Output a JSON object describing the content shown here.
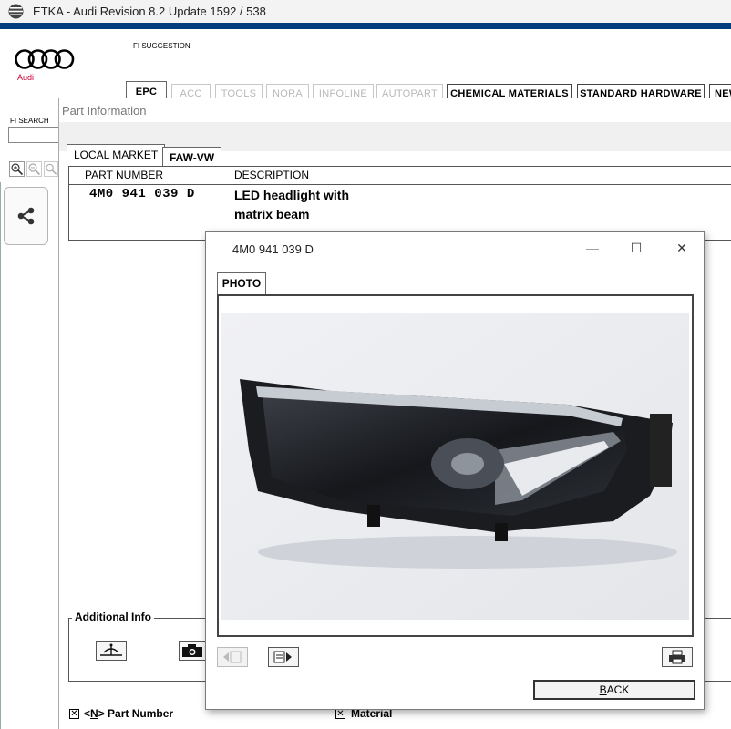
{
  "window": {
    "title": "ETKA - Audi Revision 8.2 Update 1592 / 538"
  },
  "brand": {
    "logo_text": "Audi",
    "brand_color": "#cc0033",
    "header_bar_color": "#003f7d"
  },
  "header": {
    "fi_suggestion": "FI SUGGESTION",
    "tabs": [
      {
        "label": "EPC",
        "state": "active"
      },
      {
        "label": "ACC",
        "state": "disabled"
      },
      {
        "label": "TOOLS",
        "state": "disabled"
      },
      {
        "label": "NORA",
        "state": "disabled"
      },
      {
        "label": "INFOLINE",
        "state": "disabled"
      },
      {
        "label": "AUTOPART",
        "state": "disabled"
      },
      {
        "label": "CHEMICAL MATERIALS",
        "state": "enabled"
      },
      {
        "label": "STANDARD HARDWARE",
        "state": "enabled"
      },
      {
        "label": "NEW",
        "state": "enabled"
      }
    ]
  },
  "sidebar": {
    "fi_search_label": "FI SEARCH",
    "fi_search_value": "",
    "zoom_icons": [
      "zoom-in-icon",
      "zoom-out-icon",
      "zoom-fit-icon"
    ],
    "share_icon": "share-icon"
  },
  "part_info": {
    "title": "Part Information",
    "tabs": [
      {
        "label": "LOCAL MARKET",
        "active": true
      },
      {
        "label": "FAW-VW",
        "active": false
      }
    ],
    "columns": {
      "part_number": "PART NUMBER",
      "description": "DESCRIPTION"
    },
    "rows": [
      {
        "part_number": "4M0  941  039  D",
        "description": "LED headlight with matrix beam"
      }
    ],
    "additional_info": {
      "label": "Additional Info",
      "buttons": [
        "scale-icon",
        "camera-icon"
      ]
    },
    "options": [
      {
        "label_pre": "<",
        "label_key": "N",
        "label_post": "> Part Number",
        "checked": true
      },
      {
        "label_pre": "",
        "label_key": "",
        "label_post": "Material",
        "checked": true
      }
    ]
  },
  "photo_dialog": {
    "title": "4M0 941 039 D",
    "controls": {
      "minimize": "—",
      "maximize": "☐",
      "close": "✕"
    },
    "tab": "PHOTO",
    "photo_subject": "headlight-photo",
    "nav": {
      "prev_icon": "prev-page-icon",
      "next_icon": "next-page-icon",
      "print_icon": "print-icon"
    },
    "back_button": {
      "key": "B",
      "rest": "ACK"
    }
  }
}
